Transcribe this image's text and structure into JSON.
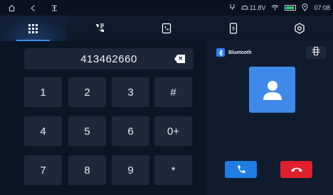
{
  "status_bar": {
    "voltage": "11.8V",
    "time": "07:08",
    "icons": [
      "home-icon",
      "back-icon",
      "menu-icon",
      "usb-icon",
      "car-icon",
      "wifi-icon",
      "battery-icon",
      "location-icon"
    ]
  },
  "tabs": [
    {
      "name": "keypad",
      "icon": "keypad-icon",
      "active": true
    },
    {
      "name": "recent-calls",
      "icon": "recent-calls-icon",
      "active": false
    },
    {
      "name": "contacts",
      "icon": "contacts-icon",
      "active": false
    },
    {
      "name": "phone-link",
      "icon": "phone-link-icon",
      "active": false
    },
    {
      "name": "settings",
      "icon": "settings-icon",
      "active": false
    }
  ],
  "dialer": {
    "number": "413462660",
    "keys": [
      "1",
      "2",
      "3",
      "#",
      "4",
      "5",
      "6",
      "0+",
      "7",
      "8",
      "9",
      "*"
    ]
  },
  "call_panel": {
    "connection_label": "Bluetooth"
  },
  "colors": {
    "accent": "#3a8bff",
    "call": "#1f7de4",
    "hangup": "#e0202e",
    "avatar": "#3f8ae8"
  }
}
